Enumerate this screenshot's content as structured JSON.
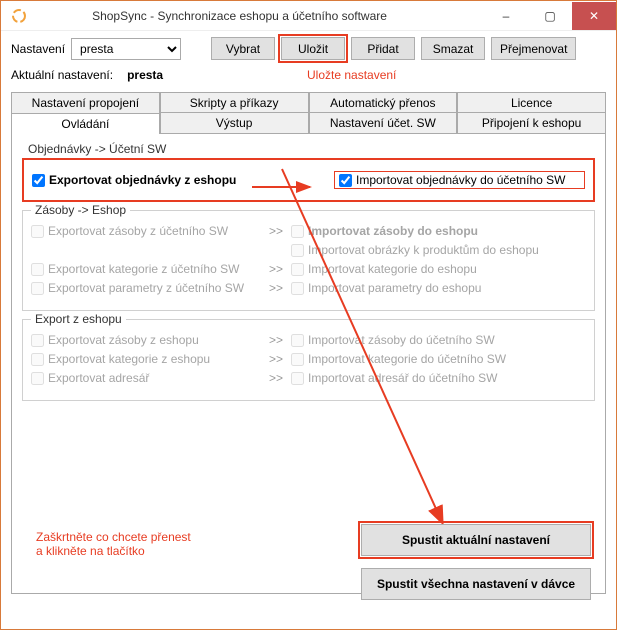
{
  "window": {
    "title": "ShopSync - Synchronizace eshopu a účetního software",
    "minimize_glyph": "–",
    "maximize_glyph": "▢",
    "close_glyph": "✕"
  },
  "top": {
    "nastaveni_label": "Nastavení",
    "preset_value": "presta",
    "buttons": {
      "vybrat": "Vybrat",
      "ulozit": "Uložit",
      "pridat": "Přidat",
      "smazat": "Smazat",
      "prejmenovat": "Přejmenovat"
    },
    "current_label": "Aktuální nastavení:",
    "current_value": "presta",
    "ulozit_hint": "Uložte nastavení"
  },
  "tabs_row1": [
    "Nastavení propojení",
    "Skripty a příkazy",
    "Automatický přenos",
    "Licence"
  ],
  "tabs_row2": [
    "Ovládání",
    "Výstup",
    "Nastavení účet. SW",
    "Připojení k eshopu"
  ],
  "active_tab": "Ovládání",
  "groups": {
    "obj": {
      "legend": "Objednávky -> Účetní SW",
      "left1": "Exportovat objednávky z eshopu",
      "right1": "Importovat objednávky do účetního SW",
      "arrow_sep": ">>"
    },
    "zasoby": {
      "legend": "Zásoby -> Eshop",
      "rows": [
        {
          "left": "Exportovat zásoby z účetního SW",
          "right": "Importovat zásoby do eshopu"
        },
        {
          "left": "",
          "right": "Importovat obrázky k produktům do eshopu"
        },
        {
          "left": "Exportovat kategorie z účetního SW",
          "right": "Importovat kategorie do eshopu"
        },
        {
          "left": "Exportovat parametry z účetního SW",
          "right": "Importovat parametry do eshopu"
        }
      ]
    },
    "export": {
      "legend": "Export z eshopu",
      "rows": [
        {
          "left": "Exportovat zásoby z eshopu",
          "right": "Importovat zásoby do účetního SW"
        },
        {
          "left": "Exportovat kategorie z eshopu",
          "right": "Importovat kategorie do účetního SW"
        },
        {
          "left": "Exportovat adresář",
          "right": "Importovat adresář do účetního SW"
        }
      ]
    }
  },
  "run_buttons": {
    "run_current": "Spustit aktuální nastavení",
    "run_all": "Spustit všechna nastavení v dávce"
  },
  "hints": {
    "check_and_click_l1": "Zaškrtněte co chcete přenest",
    "check_and_click_l2": "a klikněte na tlačítko"
  },
  "sep": ">>"
}
